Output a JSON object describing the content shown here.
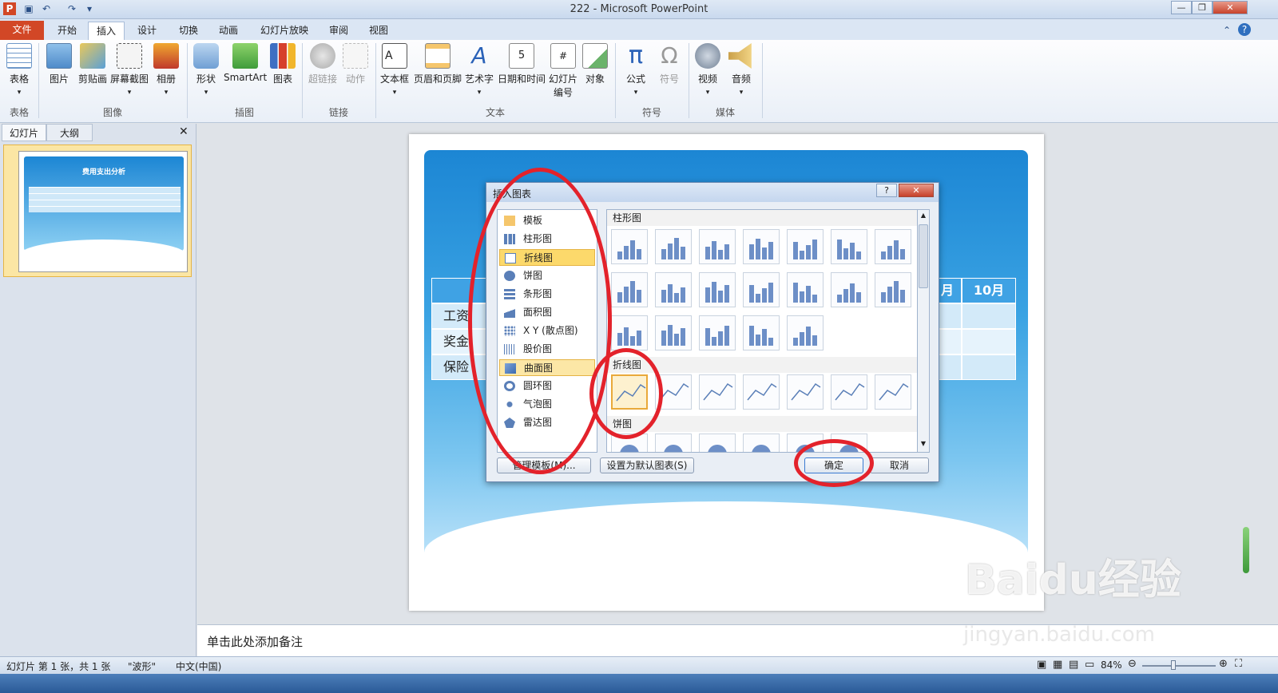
{
  "app": {
    "title": "222 - Microsoft PowerPoint",
    "minimize": "—",
    "restore": "❐",
    "close": "✕"
  },
  "tabs": {
    "file": "文件",
    "items": [
      "开始",
      "插入",
      "设计",
      "切换",
      "动画",
      "幻灯片放映",
      "审阅",
      "视图"
    ],
    "active": "插入"
  },
  "ribbon": {
    "buttons": {
      "table": "表格",
      "picture": "图片",
      "clipart": "剪贴画",
      "screenshot": "屏幕截图",
      "album": "相册",
      "shapes": "形状",
      "smartart": "SmartArt",
      "chart": "图表",
      "hyperlink": "超链接",
      "action": "动作",
      "textbox": "文本框",
      "headerfooter": "页眉和页脚",
      "wordart": "艺术字",
      "datetime": "日期和时间",
      "slidenum1": "幻灯片",
      "slidenum2": "编号",
      "object": "对象",
      "equation": "公式",
      "symbol": "符号",
      "video": "视频",
      "audio": "音频"
    },
    "groups": {
      "tables": "表格",
      "images": "图像",
      "illustrations": "插图",
      "links": "链接",
      "text": "文本",
      "symbols": "符号",
      "media": "媒体"
    }
  },
  "leftpane": {
    "tab_slides": "幻灯片",
    "tab_outline": "大纲",
    "close": "✕",
    "slide_number": "1",
    "thumb_title": "费用支出分析"
  },
  "slide": {
    "table_header_last": "10月",
    "table_header_prev": "月",
    "rows": [
      "工资",
      "奖金",
      "保险"
    ]
  },
  "dialog": {
    "title": "插入图表",
    "help": "?",
    "close": "✕",
    "categories": [
      "模板",
      "柱形图",
      "折线图",
      "饼图",
      "条形图",
      "面积图",
      "X Y (散点图)",
      "股价图",
      "曲面图",
      "圆环图",
      "气泡图",
      "雷达图"
    ],
    "selected_category": "折线图",
    "sections": {
      "column": "柱形图",
      "line": "折线图",
      "pie": "饼图"
    },
    "manage_templates": "管理模板(M)...",
    "set_default": "设置为默认图表(S)",
    "ok": "确定",
    "cancel": "取消"
  },
  "notes": {
    "placeholder": "单击此处添加备注"
  },
  "status": {
    "slide_info": "幻灯片 第 1 张，共 1 张",
    "theme": "\"波形\"",
    "language": "中文(中国)",
    "zoom": "84%"
  },
  "watermark": {
    "brand": "Baidu经验",
    "url": "jingyan.baidu.com"
  },
  "colors": {
    "file_tab": "#d24726",
    "annotation_red": "#e3222b",
    "selection": "#fcd96b",
    "slide_blue": "#1c86d4"
  }
}
